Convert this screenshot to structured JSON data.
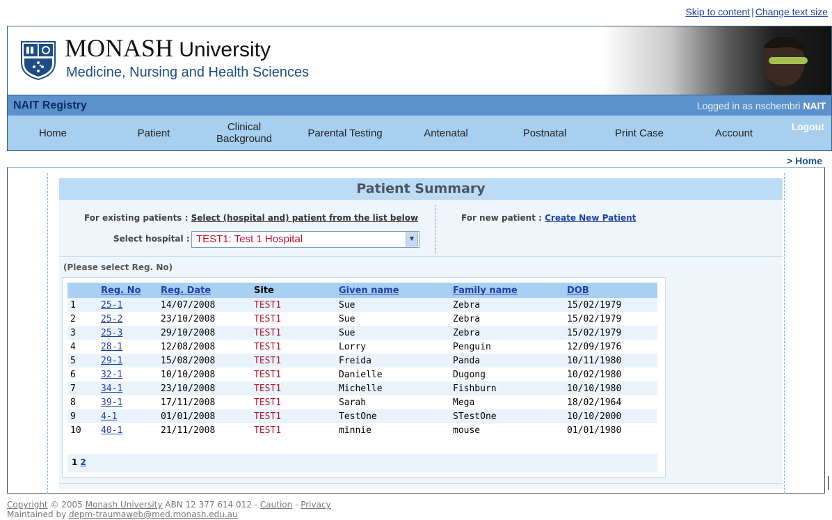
{
  "toplinks": {
    "skip": "Skip to content",
    "sep": "|",
    "text_size": "Change text size"
  },
  "header": {
    "brand_main": "MONASH",
    "brand_uni": " University",
    "brand_sub": "Medicine, Nursing and Health Sciences",
    "app_title": "NAIT Registry",
    "login_prefix": "Logged in as nschembri",
    "login_role": "NAIT"
  },
  "nav": {
    "items": [
      {
        "label": "Home"
      },
      {
        "label": "Patient"
      },
      {
        "label": "Clinical Background"
      },
      {
        "label": "Parental Testing"
      },
      {
        "label": "Antenatal"
      },
      {
        "label": "Postnatal"
      },
      {
        "label": "Print Case"
      },
      {
        "label": "Account"
      }
    ],
    "logout": "Logout"
  },
  "breadcrumb": "> Home",
  "summary": {
    "title": "Patient Summary",
    "existing_label": "For existing patients :",
    "existing_link": "Select (hospital and) patient from the list below",
    "new_label": "For new patient :",
    "new_link": "Create New Patient",
    "select_label": "Select hospital :",
    "select_value": "TEST1: Test 1 Hospital",
    "note": "(Please select Reg. No)"
  },
  "table": {
    "headers": [
      "",
      "Reg. No",
      "Reg. Date",
      "Site",
      "Given name",
      "Family name",
      "DOB"
    ],
    "rows": [
      {
        "n": "1",
        "reg": "25-1",
        "date": "14/07/2008",
        "site": "TEST1",
        "given": "Sue",
        "family": "Zebra",
        "dob": "15/02/1979"
      },
      {
        "n": "2",
        "reg": "25-2",
        "date": "23/10/2008",
        "site": "TEST1",
        "given": "Sue",
        "family": "Zebra",
        "dob": "15/02/1979"
      },
      {
        "n": "3",
        "reg": "25-3",
        "date": "29/10/2008",
        "site": "TEST1",
        "given": "Sue",
        "family": "Zebra",
        "dob": "15/02/1979"
      },
      {
        "n": "4",
        "reg": "28-1",
        "date": "12/08/2008",
        "site": "TEST1",
        "given": "Lorry",
        "family": "Penguin",
        "dob": "12/09/1976"
      },
      {
        "n": "5",
        "reg": "29-1",
        "date": "15/08/2008",
        "site": "TEST1",
        "given": "Freida",
        "family": "Panda",
        "dob": "10/11/1980"
      },
      {
        "n": "6",
        "reg": "32-1",
        "date": "10/10/2008",
        "site": "TEST1",
        "given": "Danielle",
        "family": "Dugong",
        "dob": "10/02/1980"
      },
      {
        "n": "7",
        "reg": "34-1",
        "date": "23/10/2008",
        "site": "TEST1",
        "given": "Michelle",
        "family": "Fishburn",
        "dob": "10/10/1980"
      },
      {
        "n": "8",
        "reg": "39-1",
        "date": "17/11/2008",
        "site": "TEST1",
        "given": "Sarah",
        "family": "Mega",
        "dob": "18/02/1964"
      },
      {
        "n": "9",
        "reg": "4-1",
        "date": "01/01/2008",
        "site": "TEST1",
        "given": "TestOne",
        "family": "STestOne",
        "dob": "10/10/2000"
      },
      {
        "n": "10",
        "reg": "40-1",
        "date": "21/11/2008",
        "site": "TEST1",
        "given": "minnie",
        "family": "mouse",
        "dob": "01/01/1980"
      }
    ],
    "pager_current": "1",
    "pager_next": "2"
  },
  "footer": {
    "copyright_link": "Copyright",
    "copyright_text": " © 2005 ",
    "monash_link": "Monash University",
    "abn": " ABN 12 377 614 012 - ",
    "caution": "Caution",
    "dash": " - ",
    "privacy": "Privacy",
    "maintained_prefix": "Maintained by ",
    "maintained_email": "depm-traumaweb@med.monash.edu.au"
  }
}
